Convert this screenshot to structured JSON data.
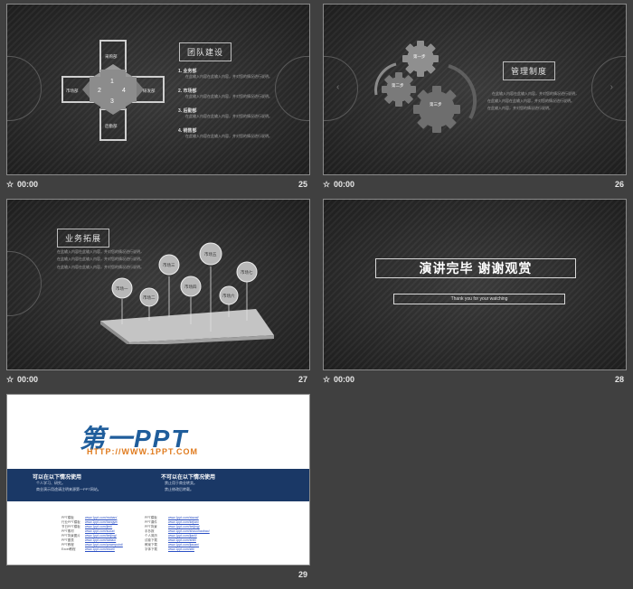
{
  "slides": [
    {
      "number": "25",
      "time": "00:00",
      "title": "团队建设",
      "depts": {
        "top": "采购部",
        "left": "市场部",
        "right": "研发部",
        "bottom": "后勤部"
      },
      "cross_numbers": [
        "1",
        "2",
        "3",
        "4"
      ],
      "items": [
        {
          "title": "1. 业务部",
          "text": "在此输入内容在此输入内容，并对您的情况进行说明。"
        },
        {
          "title": "2. 市场部",
          "text": "在此输入内容在此输入内容，并对您的情况进行说明。"
        },
        {
          "title": "3. 后勤部",
          "text": "在此输入内容在此输入内容，并对您的情况进行说明。"
        },
        {
          "title": "4. 销售部",
          "text": "在此输入内容在此输入内容，并对您的情况进行说明。"
        }
      ]
    },
    {
      "number": "26",
      "time": "00:00",
      "title": "管理制度",
      "gears": [
        "第一步",
        "第二步",
        "第三步"
      ],
      "lines": [
        "在此输入内容在此输入内容，并对您的情况进行说明，",
        "在此输入内容在此输入内容，并对您的情况进行说明。",
        "在此输入内容，并对您的情况进行说明。"
      ]
    },
    {
      "number": "27",
      "time": "00:00",
      "title": "业务拓展",
      "lines": [
        "在此输入内容在此输入内容，并对您的情况进行说明，",
        "在此输入内容在此输入内容，并对您的情况进行说明。",
        "在此输入内容在此输入内容，并对您的情况进行说明。"
      ],
      "bubbles": [
        "市场一",
        "市场二",
        "市场三",
        "市场四",
        "市场五",
        "市场六",
        "市场七"
      ]
    },
    {
      "number": "28",
      "time": "00:00",
      "title": "演讲完毕 谢谢观赏",
      "subtitle": "Thank you for your watching"
    },
    {
      "number": "29",
      "logo": "第一PPT",
      "url": "HTTP://WWW.1PPT.COM",
      "can_title": "可以在以下情况使用",
      "can_items": [
        "个人学习、研究。",
        "商业演示用途请注明来源第一PPT网站。"
      ],
      "cannot_title": "不可以在以下情况使用",
      "cannot_items": [
        "禁止用于商业转卖。",
        "禁止修改后转载。"
      ],
      "links_left": [
        "PPT模板",
        "行业PPT模板",
        "节日PPT模板",
        "PPT素材",
        "PPT背景图片",
        "PPT图表",
        "PPT教程",
        "Excel教程"
      ],
      "links_left_urls": [
        "www.1ppt.com/moban/",
        "www.1ppt.com/hangye/",
        "www.1ppt.com/jieri/",
        "www.1ppt.com/sucai/",
        "www.1ppt.com/beijing/",
        "www.1ppt.com/tubiao/",
        "www.1ppt.com/powerpoint/",
        "www.1ppt.com/excel/"
      ],
      "links_right": [
        "PPT模板",
        "PPT课件",
        "PPT背景",
        "手抄报",
        "个人简历",
        "试卷下载",
        "教案下载",
        "字体下载"
      ],
      "links_right_urls": [
        "www.1ppt.com/xiazai/",
        "www.1ppt.com/kejian/",
        "www.1ppt.com/beijing/",
        "www.1ppt.com/shouchaobao/",
        "www.1ppt.com/jianli/",
        "www.1ppt.com/shiti/",
        "www.1ppt.com/jiaoan/",
        "www.1ppt.com/ziti/"
      ]
    }
  ]
}
